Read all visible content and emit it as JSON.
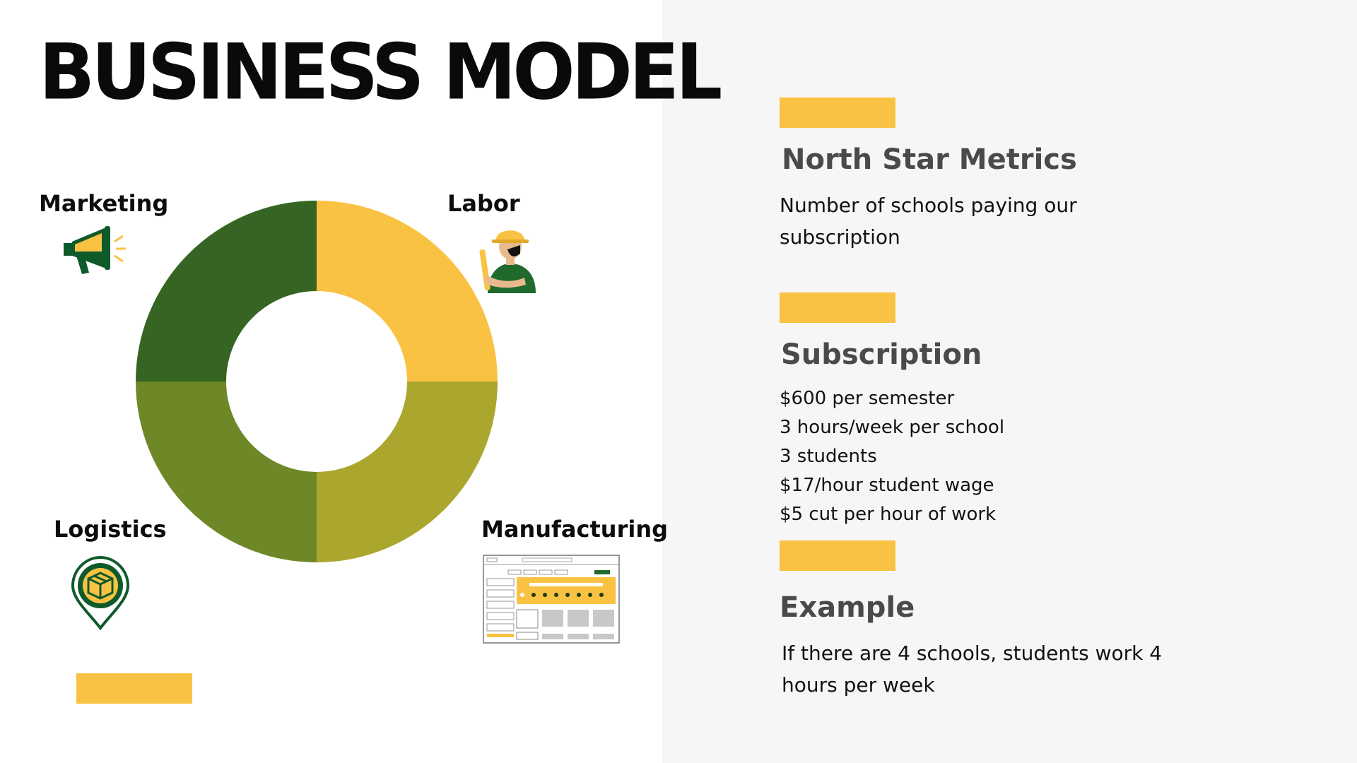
{
  "title": "BUSINESS MODEL",
  "colors": {
    "accent": "#f9c242",
    "dark_green": "#356423",
    "olive_green": "#6e8827",
    "mustard": "#aba62d",
    "yellow": "#f9c242",
    "panel_bg": "#f6f6f6"
  },
  "chart_data": {
    "type": "pie",
    "donut": true,
    "categories": [
      "Labor",
      "Manufacturing",
      "Logistics",
      "Marketing"
    ],
    "values": [
      25,
      25,
      25,
      25
    ],
    "colors": [
      "#f9c242",
      "#aba62d",
      "#6e8827",
      "#356423"
    ],
    "title": ""
  },
  "labels": {
    "marketing": "Marketing",
    "labor": "Labor",
    "logistics": "Logistics",
    "manufacturing": "Manufacturing"
  },
  "icons": {
    "marketing": "megaphone-icon",
    "labor": "construction-worker-icon",
    "logistics": "package-location-pin-icon",
    "manufacturing": "website-wireframe-icon"
  },
  "north_star": {
    "heading": "North Star Metrics",
    "text": "Number of schools paying our subscription"
  },
  "subscription": {
    "heading": "Subscription",
    "items": [
      "$600 per semester",
      "3 hours/week per school",
      "3 students",
      "$17/hour student wage",
      "$5 cut per hour of work"
    ]
  },
  "example": {
    "heading": "Example",
    "text": "If there are 4 schools, students work 4 hours per week"
  }
}
